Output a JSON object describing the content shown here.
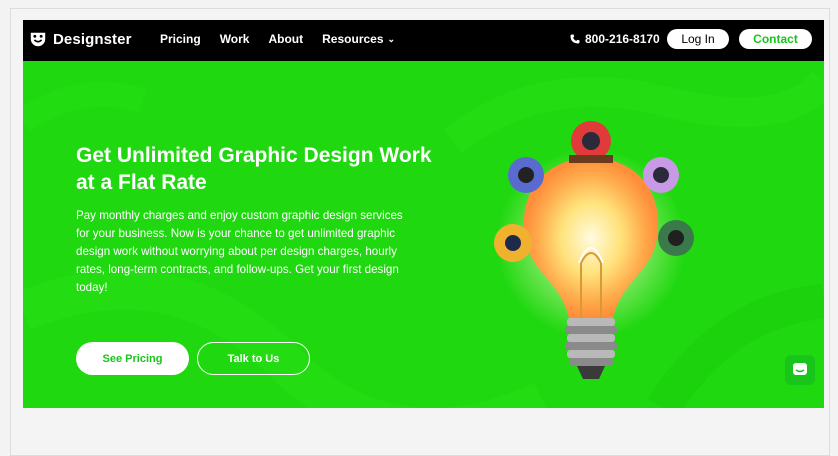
{
  "brand": {
    "name": "Designster",
    "color": "#19c51a",
    "hero_bg": "#1fd80f"
  },
  "nav": {
    "items": [
      {
        "label": "Pricing"
      },
      {
        "label": "Work"
      },
      {
        "label": "About"
      },
      {
        "label": "Resources",
        "icon": "chevron-down-icon"
      }
    ],
    "phone": "800-216-8170",
    "login_label": "Log In",
    "contact_label": "Contact"
  },
  "hero": {
    "headline": "Get Unlimited Graphic Design Work at a Flat Rate",
    "body": "Pay monthly charges and enjoy custom graphic design services for your business. Now is your chance to get unlimited graphic design work without worrying about per design charges, hourly rates, long-term contracts, and follow-ups. Get your first design today!",
    "primary_cta": "See Pricing",
    "secondary_cta": "Talk to Us",
    "illustration": "lightbulb-team-illustration"
  },
  "chat": {
    "icon": "chat-icon"
  }
}
